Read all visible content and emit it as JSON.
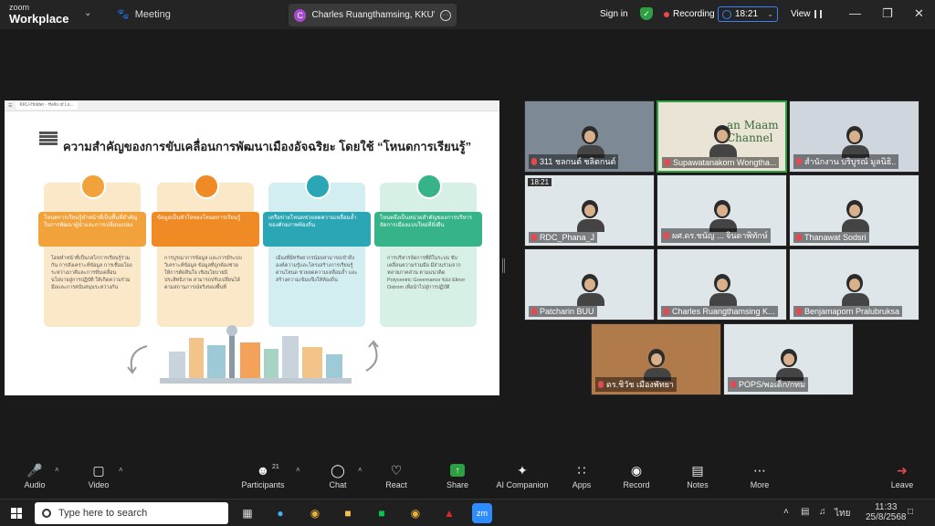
{
  "app": {
    "brand_top": "zoom",
    "brand_bottom": "Workplace",
    "meeting_label": "Meeting"
  },
  "share_pill": {
    "initial": "C",
    "title": "Charles Ruangthamsing, KKU's sc"
  },
  "topbar": {
    "signin": "Sign in",
    "recording": "Recording",
    "timer": "18:21",
    "view": "View"
  },
  "slide": {
    "tab_label": "KKU-Holder - Hello of Lo...",
    "title": "ความสำคัญของการขับเคลื่อนการพัฒนาเมืองอัจฉริยะ โดยใช้ “โหนดการเรียนรู้”",
    "cards": [
      {
        "ribbon": "โหนดการเรียนรู้ทำหน้าที่เป็นพื้นที่สำคัญในการพัฒนาผู้นำและการเปลี่ยนแปลง",
        "body": "โดยทำหน้าที่เป็นกลไกการเรียนรู้ร่วมกัน การสังเคราะห์ข้อมูล การเชื่อมโยงระหว่างภาคีและการขับเคลื่อนนโยบายสู่การปฏิบัติ ให้เกิดความร่วมมือและการสนับสนุนระหว่างกัน"
      },
      {
        "ribbon": "ข้อมูลเป็นหัวใจของโหนดการเรียนรู้",
        "body": "การบูรณาการข้อมูล และการมีระบบวิเคราะห์ข้อมูล ข้อมูลที่ถูกต้องช่วยให้การตัดสินใจ เชิงนโยบายมีประสิทธิภาพ สามารถปรับเปลี่ยนได้ตามสถานการณ์จริงของพื้นที่"
      },
      {
        "ribbon": "เครือข่ายโหนดช่วยลดความเหลื่อมล้ำของศักยภาพท้องถิ่น",
        "body": "เมืองที่มีทรัพยากรน้อยสามารถเข้าถึงองค์ความรู้และโครงสร้างการเรียนรู้ผ่านโหนด ช่วยลดความเหลื่อมล้ำ และสร้างความเข้มแข็งให้ท้องถิ่น"
      },
      {
        "ribbon": "โหนดจึงเป็นหน่วยสำคัญของการบริหารจัดการเมืองแบบใหม่ที่ยั่งยืน",
        "body": "การบริหารจัดการที่ดีในระบบ ขับเคลื่อนความร่วมมือ มีส่วนร่วมจากหลายภาคส่วน ตามแนวคิด Polycentric Governance ของ Elinor Ostrom เพื่อนำไปสู่การปฏิบัติ"
      }
    ]
  },
  "gallery": [
    {
      "name": "311 ชลกนต์ ชลิตกนต์",
      "bg": "#7d8a96"
    },
    {
      "name": "Supawatanakorn Wongtha...",
      "bg": "#e9e4d6",
      "active": true,
      "overlay": "an Maam Channel"
    },
    {
      "name": "สำนักงาน บริบูรณ์ มูลนิธิ..",
      "bg": "#cfd6dd"
    },
    {
      "name": "RDC_Phana_J",
      "bg": "#dfe6ea",
      "badge": "18:21"
    },
    {
      "name": "ผศ.ดร.ชนัญ ... จินดาพิทักษ์",
      "bg": "#dfe6ea"
    },
    {
      "name": "Thanawat Sodsri",
      "bg": "#dfe6ea"
    },
    {
      "name": "Patcharin BUU",
      "bg": "#dfe6ea"
    },
    {
      "name": "Charles Ruangthamsing  K...",
      "bg": "#dfe6ea"
    },
    {
      "name": "Benjamaporn Pralubruksa",
      "bg": "#dfe6ea"
    }
  ],
  "bottom_tiles": [
    {
      "name": "ดร.ชิวัช เมืองพัทยา",
      "bg": "#b07a4a"
    },
    {
      "name": "POPS/พอเด็ก/กทม",
      "bg": "#dfe6ea"
    }
  ],
  "toolbar": {
    "audio": "Audio",
    "video": "Video",
    "participants": "Participants",
    "participants_count": "21",
    "chat": "Chat",
    "react": "React",
    "share": "Share",
    "ai": "AI Companion",
    "apps": "Apps",
    "record": "Record",
    "notes": "Notes",
    "more": "More",
    "leave": "Leave"
  },
  "taskbar": {
    "search": "Type here to search",
    "time": "11:33",
    "date": "25/8/2568",
    "lang": "ไทย"
  },
  "colors": {
    "share_green": "#2ea043",
    "leave_red": "#e5484d",
    "accent_blue": "#3b82f6"
  }
}
